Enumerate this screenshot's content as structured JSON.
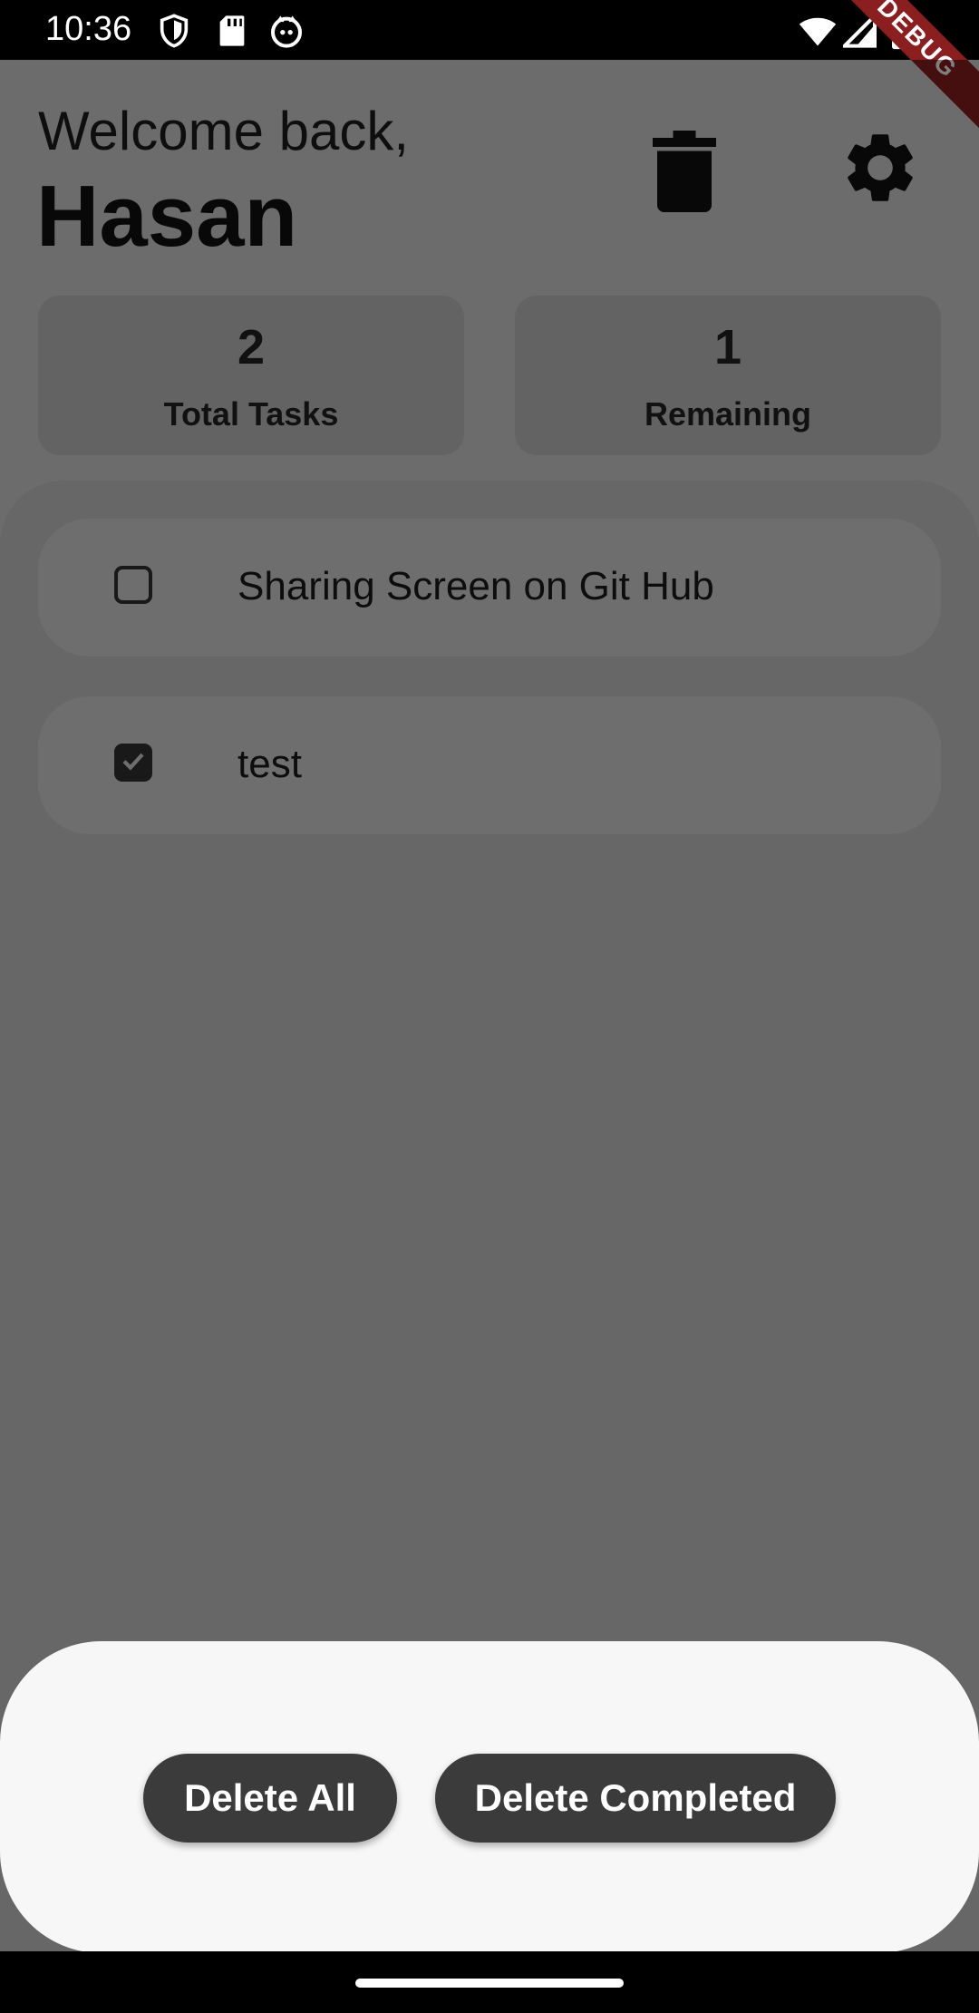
{
  "status_bar": {
    "time": "10:36",
    "left_icons": [
      "shield-icon",
      "sd-card-icon",
      "github-cat-icon"
    ],
    "right_icons": [
      "wifi-icon",
      "signal-icon",
      "battery-icon"
    ]
  },
  "debug_banner": "DEBUG",
  "header": {
    "greeting": "Welcome back,",
    "username": "Hasan",
    "actions": [
      "trash-icon",
      "gear-icon"
    ]
  },
  "stats": {
    "total_value": "2",
    "total_label": "Total Tasks",
    "remaining_value": "1",
    "remaining_label": "Remaining"
  },
  "tasks": [
    {
      "title": "Sharing Screen on Git Hub",
      "done": false
    },
    {
      "title": "test",
      "done": true
    }
  ],
  "sheet": {
    "delete_all_label": "Delete All",
    "delete_completed_label": "Delete Completed"
  },
  "colors": {
    "button_bg": "#3b3b3b",
    "sheet_bg": "#f7f7f7",
    "banner": "#8b1e1e"
  }
}
